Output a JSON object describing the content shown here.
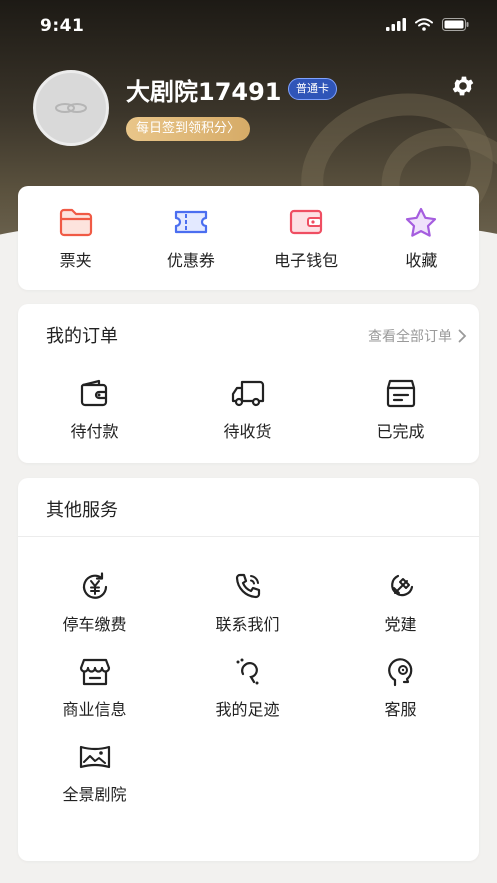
{
  "status_bar": {
    "time": "9:41"
  },
  "profile": {
    "username": "大剧院17491",
    "card_type": "普通卡",
    "checkin_label": "每日签到领积分〉"
  },
  "quick_actions": [
    {
      "label": "票夹",
      "icon": "folder-icon",
      "color": "#f05a45"
    },
    {
      "label": "优惠券",
      "icon": "ticket-icon",
      "color": "#4b6ef0"
    },
    {
      "label": "电子钱包",
      "icon": "wallet-icon",
      "color": "#ef4e62"
    },
    {
      "label": "收藏",
      "icon": "star-icon",
      "color": "#a55ddf"
    }
  ],
  "orders": {
    "title": "我的订单",
    "see_all": "查看全部订单",
    "items": [
      {
        "label": "待付款",
        "icon": "wallet-outline-icon"
      },
      {
        "label": "待收货",
        "icon": "truck-icon"
      },
      {
        "label": "已完成",
        "icon": "box-icon"
      }
    ]
  },
  "services": {
    "title": "其他服务",
    "items": [
      {
        "label": "停车缴费",
        "icon": "yuan-refresh-icon"
      },
      {
        "label": "联系我们",
        "icon": "phone-icon"
      },
      {
        "label": "党建",
        "icon": "party-emblem-icon"
      },
      {
        "label": "商业信息",
        "icon": "store-icon"
      },
      {
        "label": "我的足迹",
        "icon": "footprint-icon"
      },
      {
        "label": "客服",
        "icon": "service-head-icon"
      },
      {
        "label": "全景剧院",
        "icon": "panorama-icon"
      }
    ]
  }
}
